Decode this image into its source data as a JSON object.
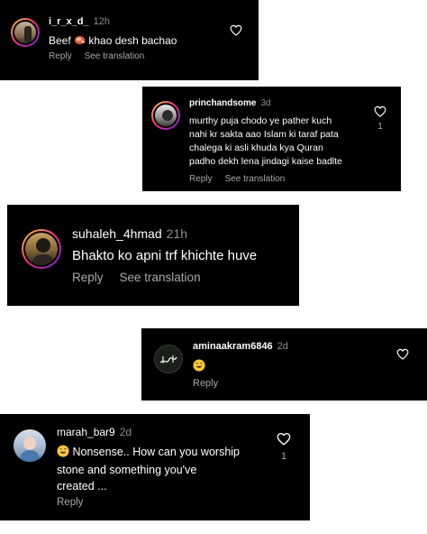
{
  "comments": [
    {
      "username": "i_r_x_d_",
      "age": "12h",
      "text_before": "Beef",
      "emoji_inline": "meat-emoji",
      "text_after": "khao desh bachao",
      "reply_label": "Reply",
      "translate_label": "See translation"
    },
    {
      "username": "princhandsome",
      "age": "3d",
      "lines": [
        "murthy puja chodo ye pather kuch",
        "nahi kr sakta aao Islam ki taraf pata",
        "chalega ki asli khuda kya Quran",
        "padho dekh lena jindagi kaise badlte"
      ],
      "likes": "1",
      "reply_label": "Reply",
      "translate_label": "See translation"
    },
    {
      "username": "suhaleh_4hmad",
      "age": "21h",
      "text": "Bhakto ko apni trf khichte huve",
      "reply_label": "Reply",
      "translate_label": "See translation"
    },
    {
      "username": "aminaakram6846",
      "age": "2d",
      "emoji": "laughing-emoji",
      "reply_label": "Reply"
    },
    {
      "username": "marah_bar9",
      "age": "2d",
      "emoji": "laughing-emoji",
      "lines": [
        "Nonsense.. How can you worship",
        "stone and something you've",
        "created ..."
      ],
      "likes": "1",
      "reply_label": "Reply"
    }
  ],
  "colors": {
    "background": "#000000",
    "text": "#ffffff",
    "meta": "#8e8e8e",
    "action": "#a8a8a8"
  }
}
